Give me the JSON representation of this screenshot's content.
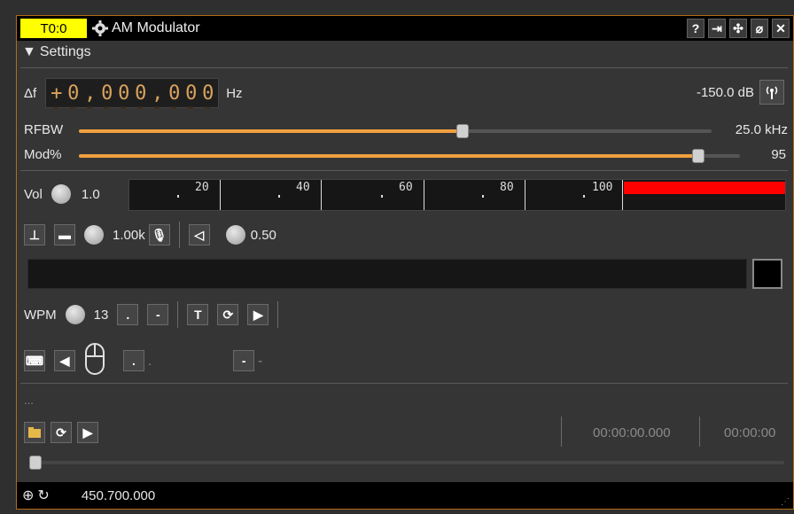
{
  "titlebar": {
    "tag": "T0:0",
    "title": "AM Modulator",
    "buttons": [
      "help-icon",
      "move-to-workspace-icon",
      "shrink-icon",
      "hide-icon",
      "close-icon"
    ]
  },
  "settings": {
    "label": "Settings"
  },
  "freq": {
    "label": "Δf",
    "sign": "+",
    "digits": [
      "0",
      ",",
      "0",
      "0",
      "0",
      ",",
      "0",
      "0",
      "0"
    ],
    "unit": "Hz",
    "power": "-150.0 dB"
  },
  "rfbw": {
    "label": "RFBW",
    "value": "25.0 kHz",
    "level": 0.59
  },
  "mod": {
    "label": "Mod%",
    "value": "95",
    "level": 0.95
  },
  "vol": {
    "label": "Vol",
    "value": "1.0"
  },
  "meter": {
    "ticks": [
      "20",
      "40",
      "60",
      "80",
      "100"
    ],
    "level_color": "#ff0000"
  },
  "audio": {
    "tone_value": "1.00k",
    "volume_value": "0.50"
  },
  "morse": {
    "wpm_label": "WPM",
    "wpm_value": "13",
    "dot_label": ".",
    "dash_label": "-",
    "text_button": "T",
    "dot_indicator": ".",
    "dash_indicator": "-"
  },
  "file": {
    "name": "...",
    "time_current": "00:00:00.000",
    "time_total": "00:00:00"
  },
  "statusbar": {
    "frequency": "450.700.000"
  }
}
